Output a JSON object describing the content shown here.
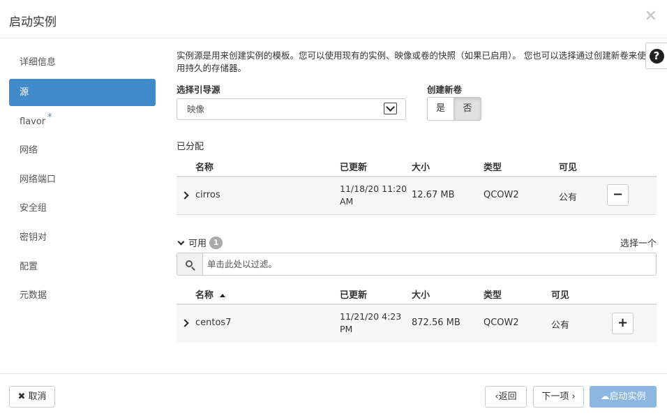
{
  "header": {
    "title": "启动实例",
    "close": "×"
  },
  "sidebar": {
    "items": [
      {
        "label": "详细信息"
      },
      {
        "label": "源"
      },
      {
        "label": "flavor",
        "required": "*"
      },
      {
        "label": "网络"
      },
      {
        "label": "网络端口"
      },
      {
        "label": "安全组"
      },
      {
        "label": "密钥对"
      },
      {
        "label": "配置"
      },
      {
        "label": "元数据"
      }
    ]
  },
  "help": {
    "icon": "?"
  },
  "description": "实例源是用来创建实例的模板。您可以使用现有的实例、映像或卷的快照（如果已启用）。 您也可以选择通过创建新卷来使用持久的存储器。",
  "boot_source": {
    "label": "选择引导源",
    "value": "映像"
  },
  "new_volume": {
    "label": "创建新卷",
    "yes": "是",
    "no": "否"
  },
  "allocated": {
    "label": "已分配",
    "columns": [
      "名称",
      "已更新",
      "大小",
      "类型",
      "可见"
    ],
    "rows": [
      {
        "name": "cirros",
        "updated_line1": "11/18/20 11:20",
        "updated_line2": "AM",
        "size": "12.67 MB",
        "type": "QCOW2",
        "visibility": "公有",
        "action": "−"
      }
    ]
  },
  "available": {
    "label": "可用",
    "count": "1",
    "select_one": "选择一个",
    "filter_placeholder": "单击此处以过滤。",
    "columns": [
      "名称",
      "已更新",
      "大小",
      "类型",
      "可见"
    ],
    "rows": [
      {
        "name": "centos7",
        "updated_line1": "11/21/20 4:23",
        "updated_line2": "PM",
        "size": "872.56 MB",
        "type": "QCOW2",
        "visibility": "公有",
        "action": "+"
      }
    ]
  },
  "footer": {
    "cancel": "取消",
    "back": "返回",
    "next": "下一项",
    "launch": "启动实例"
  }
}
